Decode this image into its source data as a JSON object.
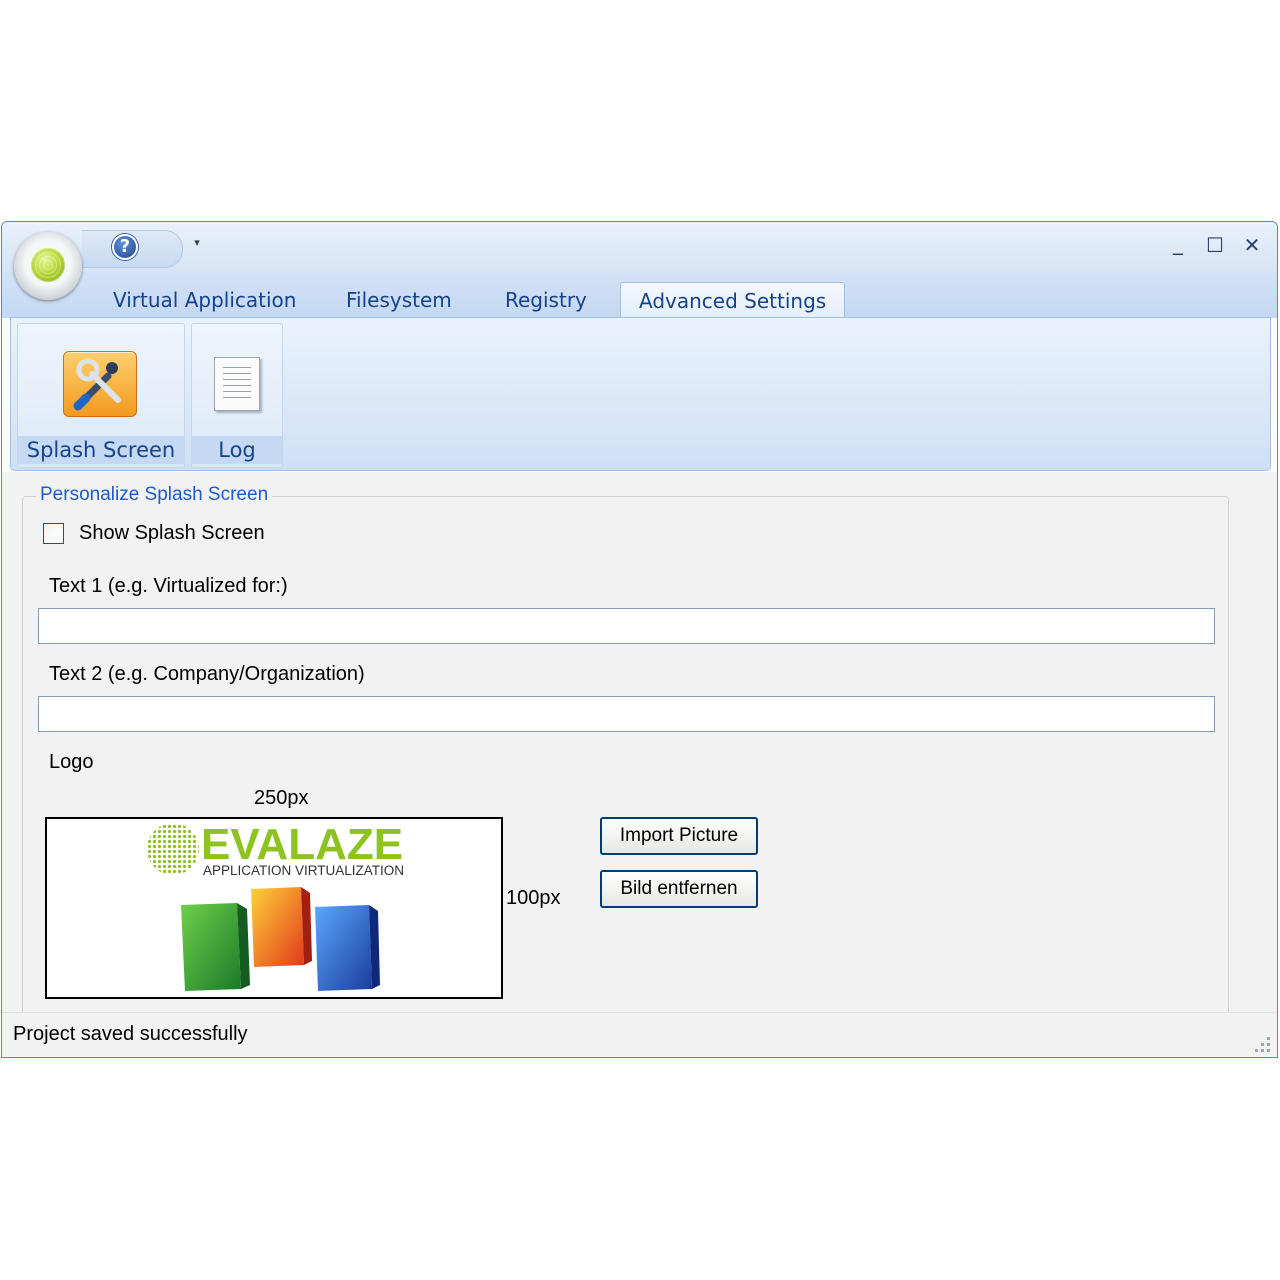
{
  "window": {
    "minimize": "_",
    "maximize": "☐",
    "close": "✕"
  },
  "quick_access": {
    "help_glyph": "?",
    "dropdown_glyph": "▾"
  },
  "tabs": [
    {
      "label": "Virtual Application",
      "active": false
    },
    {
      "label": "Filesystem",
      "active": false
    },
    {
      "label": "Registry",
      "active": false
    },
    {
      "label": "Advanced Settings",
      "active": true
    }
  ],
  "ribbon": {
    "buttons": [
      {
        "label": "Splash Screen",
        "icon": "tools-icon"
      },
      {
        "label": "Log",
        "icon": "document-icon"
      }
    ]
  },
  "splash": {
    "group_title": "Personalize Splash Screen",
    "show_checkbox_label": "Show Splash Screen",
    "show_checked": false,
    "text1_label": "Text 1 (e.g. Virtualized for:)",
    "text1_value": "",
    "text2_label": "Text 2 (e.g. Company/Organization)",
    "text2_value": "",
    "logo_label": "Logo",
    "width_hint": "250px",
    "height_hint": "100px",
    "import_button": "Import Picture",
    "remove_button": "Bild entfernen",
    "logo": {
      "brand": "EVALAZE",
      "tagline": "APPLICATION VIRTUALIZATION",
      "box_label": "EVALAZE"
    }
  },
  "status": {
    "text": "Project saved successfully"
  },
  "colors": {
    "accent_blue": "#15428b",
    "group_title": "#1a5ccc",
    "brand_green": "#8dc21f"
  }
}
